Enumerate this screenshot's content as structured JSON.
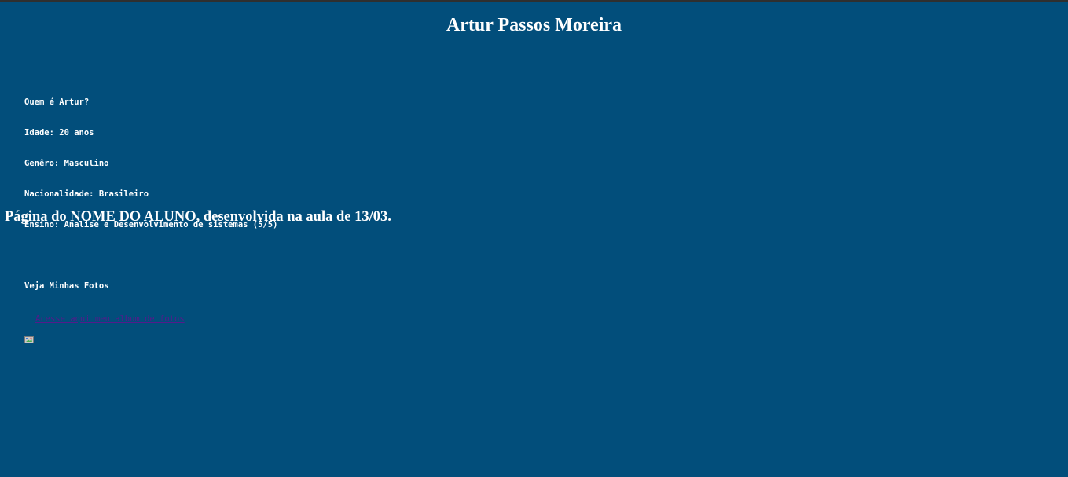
{
  "header": {
    "title": "Artur Passos Moreira"
  },
  "profile": {
    "lines": [
      "Quem é Artur?",
      "Idade: 20 anos",
      "Genêro: Masculino",
      "Nacionalidade: Brasileiro",
      "Ensino: Analise e Desenvolvimento de sistemas (5/5)"
    ],
    "photos_heading": "Veja Minhas Fotos",
    "album_link": "Acesse aqui meu album de fotos",
    "album_icon": "broken-image-icon"
  },
  "footer": {
    "text": "Página do NOME DO ALUNO, desenvolvida na aula de 13/03."
  },
  "colors": {
    "background": "#024e7b",
    "text": "#ffffff",
    "visited_link": "#551a8b"
  }
}
